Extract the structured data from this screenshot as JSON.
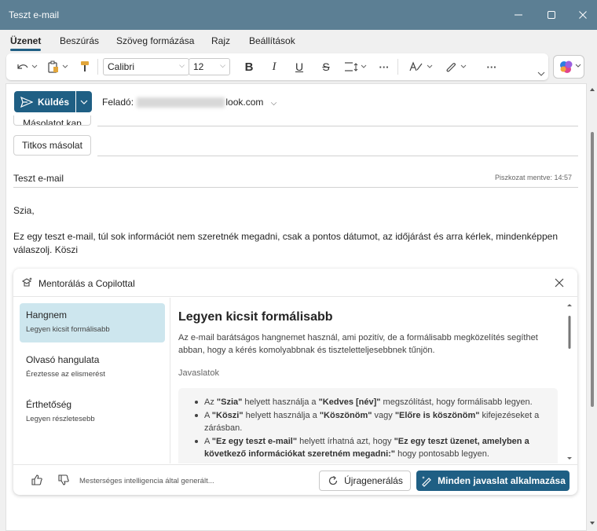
{
  "window": {
    "title": "Teszt e-mail"
  },
  "menu": {
    "items": [
      {
        "label": "Üzenet",
        "active": true
      },
      {
        "label": "Beszúrás"
      },
      {
        "label": "Szöveg formázása"
      },
      {
        "label": "Rajz"
      },
      {
        "label": "Beállítások"
      }
    ]
  },
  "ribbon": {
    "font": "Calibri",
    "size": "12",
    "more": "···"
  },
  "compose": {
    "send_label": "Küldés",
    "from_label": "Feladó:",
    "from_suffix": "look.com",
    "cc_label": "Másolatot kap",
    "bcc_label": "Titkos másolat",
    "subject": "Teszt e-mail",
    "draft_saved": "Piszkozat mentve: 14:57",
    "greeting": "Szia,",
    "body": "Ez egy teszt e-mail, túl sok információt nem szeretnék megadni, csak a pontos dátumot, az időjárást és arra kérlek, mindenképpen válaszolj. Köszi"
  },
  "copilot": {
    "title": "Mentorálás a Copilottal",
    "nav": [
      {
        "title": "Hangnem",
        "subtitle": "Legyen kicsit formálisabb",
        "selected": true
      },
      {
        "title": "Olvasó hangulata",
        "subtitle": "Éreztesse az elismerést"
      },
      {
        "title": "Érthetőség",
        "subtitle": "Legyen részletesebb"
      }
    ],
    "content": {
      "heading": "Legyen kicsit formálisabb",
      "description": "Az e-mail barátságos hangnemet használ, ami pozitív, de a formálisabb megközelítés segíthet abban, hogy a kérés komolyabbnak és tiszteletteljesebbnek tűnjön.",
      "suggestions_label": "Javaslatok"
    },
    "footer": {
      "ai_note": "Mesterséges intelligencia által generált...",
      "regenerate": "Újragenerálás",
      "apply_all": "Minden javaslat alkalmazása"
    }
  },
  "colors": {
    "titlebar": "#5c7f94",
    "accent": "#1f5f84",
    "selected_nav": "#cde6ee"
  }
}
